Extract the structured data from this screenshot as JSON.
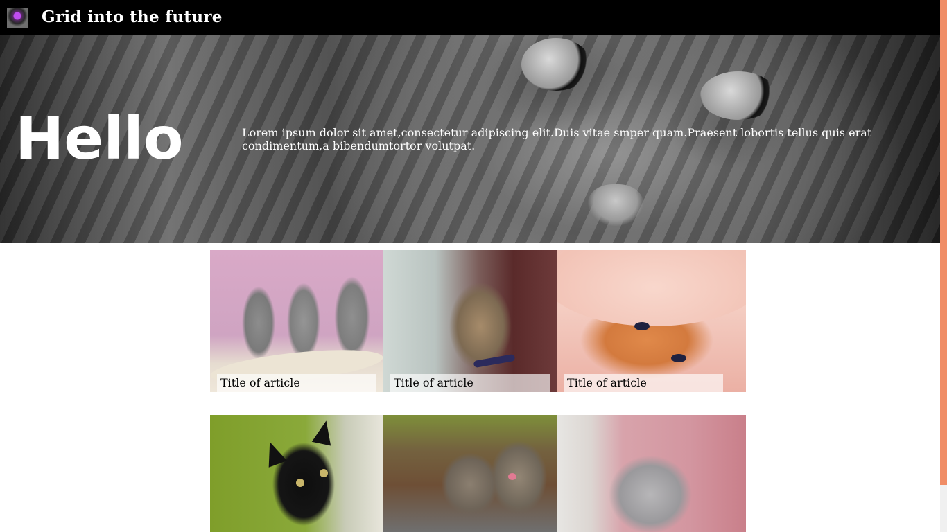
{
  "header": {
    "logo_icon": "crystal-ball-icon",
    "title": "Grid into the future",
    "background": "#000000"
  },
  "hero": {
    "heading": "Hello",
    "text": "Lorem ipsum dolor sit amet,consectetur adipiscing elit.Duis vitae smper quam.Praesent lobortis tellus quis erat condimentum,a bibendumtortor volutpat."
  },
  "articles": [
    {
      "title": "Title of article",
      "image": "three-grey-kittens"
    },
    {
      "title": "Title of article",
      "image": "tabby-cat-with-woman"
    },
    {
      "title": "Title of article",
      "image": "orange-kitten-in-towel"
    },
    {
      "title": "",
      "image": "black-cat"
    },
    {
      "title": "",
      "image": "two-tabby-kittens"
    },
    {
      "title": "",
      "image": "grey-fluffy-kitten"
    }
  ],
  "scrollbar": {
    "thumb_color": "#f08d66"
  }
}
